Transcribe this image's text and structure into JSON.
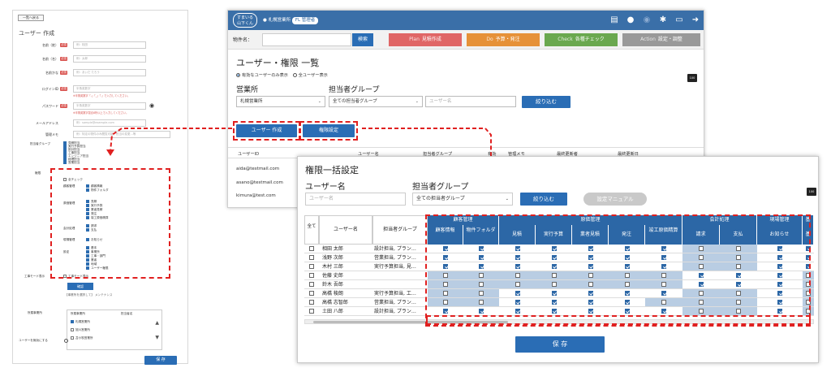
{
  "left_panel": {
    "back_label": "一覧へ戻る",
    "title": "ユーザー 作成",
    "fields": [
      {
        "label": "名前（姓）",
        "required": "必須",
        "placeholder": "例：相田"
      },
      {
        "label": "名前（名）",
        "required": "必須",
        "placeholder": "例：太郎"
      },
      {
        "label": "名前かな",
        "required": "必須",
        "placeholder": "例：あいだ たろう"
      },
      {
        "label": "ログインID",
        "required": "必須",
        "placeholder": "半角英数字",
        "warning": "※半角英数字「-」「_」「.」で入力してください。"
      },
      {
        "label": "パスワード",
        "required": "必須",
        "placeholder": "半角英数字",
        "warning": "※半角英数字混合8桁以上で入力してください。"
      },
      {
        "label": "メールアドレス",
        "required": "",
        "placeholder": "例：sample@example.com"
      },
      {
        "label": "管理メモ",
        "required": "",
        "placeholder": "例：特定の物件のみ閲覧可能、担当の変更...等"
      }
    ],
    "group_label": "担当者グループ",
    "group_items": [
      "見積担当",
      "実行予算担当",
      "設計担当",
      "工事担当",
      "エンジニア担当",
      "経理担当",
      "営業担当"
    ],
    "perm_label": "権限",
    "all_check": "全チェック",
    "perm_sections": [
      {
        "name": "顧客管理",
        "items": [
          "顧客情報",
          "物件フォルダ"
        ]
      },
      {
        "name": "原価管理",
        "items": [
          "見積",
          "実行予算",
          "業者見積",
          "発注",
          "竣工原価精算"
        ]
      },
      {
        "name": "会計処理",
        "items": [
          "請求",
          "支払"
        ]
      },
      {
        "name": "現場管理",
        "items": [
          "お知らせ"
        ]
      },
      {
        "name": "設定",
        "items": [
          "基本",
          "事業所",
          "工事・部門",
          "業者",
          "地域",
          "ユーザー権限"
        ]
      }
    ],
    "notice_label": "工事モード表示",
    "notice_value": "工事モード表示",
    "ok_label": "確認",
    "dept_label": "所属事業所",
    "dept_note": "【事業所を選択して】\nメンテナンス",
    "dept_head": [
      "所属事業所",
      "担当者名"
    ],
    "depts": [
      "札幌営業所",
      "旭川営業所",
      "苫小牧営業所"
    ],
    "active_label": "ユーザーを無効にする",
    "save_label": "保 存"
  },
  "app": {
    "logo": "すまいる\n山下くん",
    "user_badge": "札幌営業所",
    "user_role": "FL 管理者",
    "search_label": "物件名：",
    "search_btn": "検索",
    "phases": [
      {
        "tag": "Plan",
        "label": "見積作成",
        "color": "#e06666"
      },
      {
        "tag": "Do",
        "label": "予算・発注",
        "color": "#e69138"
      },
      {
        "tag": "Check",
        "label": "各種チェック",
        "color": "#6aa84f"
      },
      {
        "tag": "Action",
        "label": "設定・調整",
        "color": "#999999"
      }
    ],
    "title": "ユーザー・権限 一覧",
    "radio_active": "有効なユーザーのみ表示",
    "radio_all": "全ユーザー表示",
    "office_label": "営業所",
    "office_value": "札幌営業所",
    "group_label": "担当者グループ",
    "group_value": "全ての担当者グループ",
    "name_placeholder": "ユーザー名",
    "filter_btn": "絞り込む",
    "create_btn": "ユーザー 作成",
    "perm_btn": "権限設定",
    "table_head": [
      "ユーザーID",
      "ユーザー名",
      "担当者グループ",
      "有効",
      "管理メモ",
      "最終更新者",
      "最終更新日"
    ],
    "rows": [
      "aida@testmail.com",
      "asano@testmail.com",
      "kimura@test.com"
    ],
    "print_icon": "100"
  },
  "bulk": {
    "title": "権限一括設定",
    "user_label": "ユーザー名",
    "user_placeholder": "ユーザー名",
    "group_label": "担当者グループ",
    "group_value": "全ての担当者グループ",
    "filter_btn": "絞り込む",
    "manual_btn": "設定マニュアル",
    "col_all": "全て",
    "col_user": "ユーザー名",
    "col_group": "担当者グループ",
    "groups": [
      {
        "name": "顧客管理",
        "cols": [
          "顧客情報",
          "物件フォルダ"
        ]
      },
      {
        "name": "原価管理",
        "cols": [
          "見積",
          "実行予算",
          "業者見積",
          "発注",
          "竣工原価精算"
        ]
      },
      {
        "name": "会計処理",
        "cols": [
          "請求",
          "支払"
        ]
      },
      {
        "name": "現場管理",
        "cols": [
          "お知らせ"
        ]
      },
      {
        "name": "基",
        "cols": [
          "基"
        ]
      }
    ],
    "users": [
      {
        "name": "相田 太郎",
        "group": "設計担当, プラン…",
        "perms": [
          1,
          1,
          1,
          1,
          1,
          1,
          1,
          0,
          0,
          1,
          1
        ]
      },
      {
        "name": "浅野 次郎",
        "group": "営業担当, プラン…",
        "perms": [
          1,
          1,
          1,
          1,
          1,
          1,
          1,
          0,
          0,
          1,
          1
        ]
      },
      {
        "name": "木村 三郎",
        "group": "実行予算担当, 見…",
        "perms": [
          1,
          1,
          1,
          1,
          1,
          1,
          1,
          0,
          0,
          1,
          1
        ]
      },
      {
        "name": "佐藤 史郎",
        "group": "",
        "perms": [
          0,
          0,
          0,
          0,
          0,
          0,
          0,
          1,
          1,
          1,
          0
        ]
      },
      {
        "name": "鈴木 吾郎",
        "group": "",
        "perms": [
          0,
          0,
          0,
          0,
          0,
          0,
          0,
          1,
          1,
          1,
          0
        ]
      },
      {
        "name": "高橋 稜朗",
        "group": "実行予算担当, 工…",
        "perms": [
          0,
          0,
          1,
          1,
          1,
          1,
          1,
          0,
          0,
          1,
          0
        ]
      },
      {
        "name": "高橋 志智郎",
        "group": "営業担当, プラン…",
        "perms": [
          0,
          0,
          1,
          1,
          1,
          1,
          0,
          0,
          0,
          1,
          0
        ]
      },
      {
        "name": "土田 八郎",
        "group": "設計担当, プラン…",
        "perms": [
          1,
          1,
          1,
          1,
          1,
          1,
          1,
          0,
          0,
          1,
          0
        ]
      }
    ],
    "save_btn": "保 存",
    "print_icon": "100"
  }
}
